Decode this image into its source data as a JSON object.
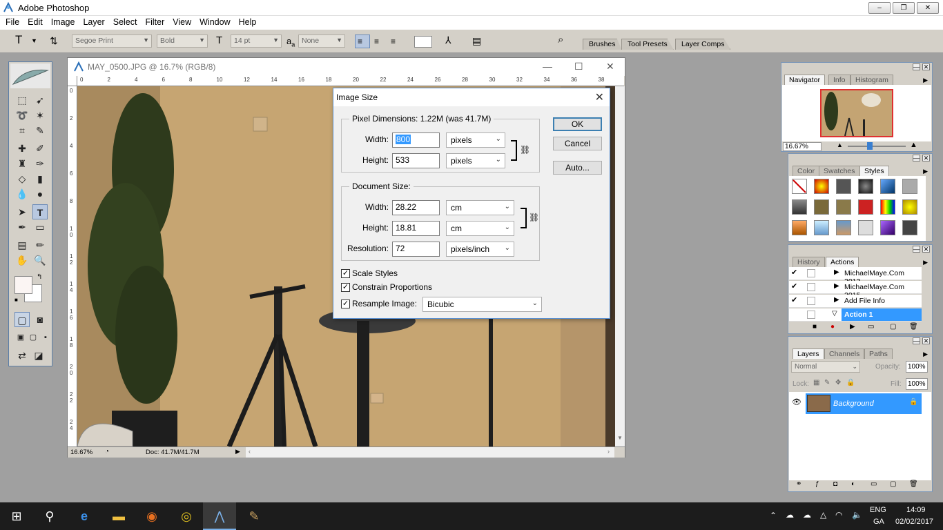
{
  "app": {
    "title": "Adobe Photoshop",
    "window_buttons": [
      "–",
      "❐",
      "✕"
    ]
  },
  "menu": [
    "File",
    "Edit",
    "Image",
    "Layer",
    "Select",
    "Filter",
    "View",
    "Window",
    "Help"
  ],
  "options_bar": {
    "tool_glyph": "T",
    "font_family": "Segoe Print",
    "font_style": "Bold",
    "font_size": "14 pt",
    "aa_label": "a",
    "aa_sub": "a",
    "anti_alias": "None",
    "palette_tabs": [
      "Brushes",
      "Tool Presets",
      "Layer Comps"
    ]
  },
  "document": {
    "title": "MAY_0500.JPG @ 16.7% (RGB/8)",
    "hruler_ticks": [
      "0",
      "2",
      "4",
      "6",
      "8",
      "10",
      "12",
      "14",
      "16",
      "18",
      "20",
      "22",
      "24",
      "26",
      "28",
      "30",
      "32",
      "34",
      "36",
      "38"
    ],
    "vruler_ticks": [
      "0",
      "2",
      "4",
      "6",
      "8",
      "10",
      "12",
      "14",
      "16",
      "18",
      "20",
      "22",
      "24"
    ],
    "zoom": "16.67%",
    "doc_info": "Doc: 41.7M/41.7M"
  },
  "dialog": {
    "title": "Image Size",
    "pixel_dimensions_label": "Pixel Dimensions:  1.22M (was 41.7M)",
    "px_width_label": "Width:",
    "px_width_value": "800",
    "px_width_unit": "pixels",
    "px_height_label": "Height:",
    "px_height_value": "533",
    "px_height_unit": "pixels",
    "document_size_label": "Document Size:",
    "doc_width_label": "Width:",
    "doc_width_value": "28.22",
    "doc_width_unit": "cm",
    "doc_height_label": "Height:",
    "doc_height_value": "18.81",
    "doc_height_unit": "cm",
    "resolution_label": "Resolution:",
    "resolution_value": "72",
    "resolution_unit": "pixels/inch",
    "scale_styles": "Scale Styles",
    "constrain_proportions": "Constrain Proportions",
    "resample_image": "Resample Image:",
    "resample_method": "Bicubic",
    "ok": "OK",
    "cancel": "Cancel",
    "auto": "Auto..."
  },
  "navigator": {
    "tabs": [
      "Navigator",
      "Info",
      "Histogram"
    ],
    "zoom": "16.67%"
  },
  "styles": {
    "tabs": [
      "Color",
      "Swatches",
      "Styles"
    ]
  },
  "actions": {
    "tabs": [
      "History",
      "Actions"
    ],
    "rows": [
      {
        "label": "MichaelMaye.Com 2013",
        "checked": true
      },
      {
        "label": "MichaelMaye.Com 2015",
        "checked": true
      },
      {
        "label": "Add File Info",
        "checked": true
      },
      {
        "label": "Action 1",
        "checked": false
      }
    ]
  },
  "layers": {
    "tabs": [
      "Layers",
      "Channels",
      "Paths"
    ],
    "blend_mode": "Normal",
    "opacity_label": "Opacity:",
    "opacity": "100%",
    "lock_label": "Lock:",
    "fill_label": "Fill:",
    "fill": "100%",
    "layer_name": "Background"
  },
  "taskbar": {
    "lang_top": "ENG",
    "lang_bottom": "GA",
    "time": "14:09",
    "date": "02/02/2017"
  },
  "colors": {
    "accent": "#3399ff",
    "dialog_border": "#5a8fd0",
    "panel": "#d4d0c8"
  }
}
